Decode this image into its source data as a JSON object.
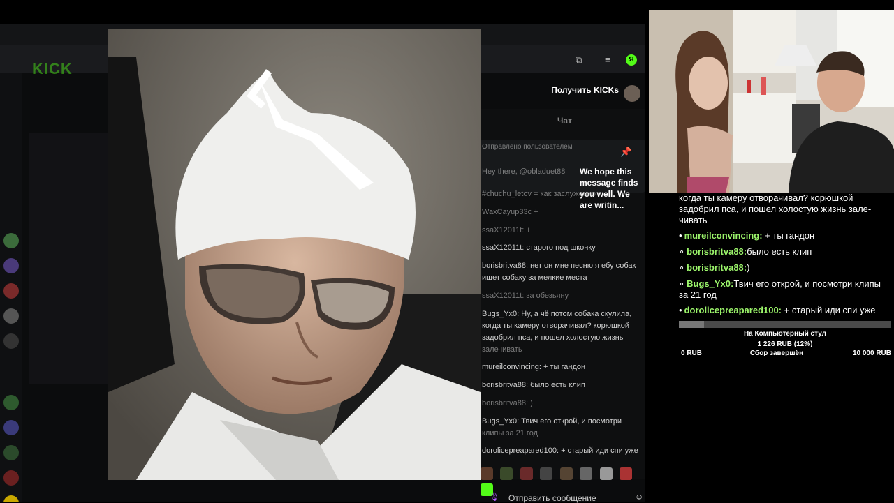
{
  "browser": {
    "logo": "KICK",
    "get_kicks": "Получить KICKs",
    "avatar_letter": "Я",
    "chat_tab": "Чат",
    "pinned_by": "Отправлено пользователем",
    "pinned_text": "We hope this message finds you well. We are writin...",
    "send_placeholder": "Отправить сообщение",
    "chat_lines": [
      "Hey there, @obladuet88",
      "#chuchu_letov = как заслуженно",
      "WaxCayup33c +",
      "ssaX12011t: +",
      "ssaX12011t: старого под шконку",
      "borisbritva88: нет он мне песню я ебу собак",
      "ищет собаку за мелкие места",
      "ssaX12011t: за обезьяну",
      "Bugs_Yx0: Ну, а чё потом собака скулила,",
      "когда ты камеру отворачивал? корюшкой",
      "задобрил пса, и пошел холостую жизнь",
      "залечивать",
      "mureilconvincing: + ты гандон",
      "borisbritva88: было есть клип",
      "borisbritva88: )",
      "Bugs_Yx0: Твич его открой, и посмотри",
      "клипы за 21 год",
      "dorolicepreapared100: + старый иди спи уже"
    ]
  },
  "overlay_chat": {
    "continuation": "когда ты камеру отворачивал? корюшкой задобрил пса, и пошел холостую жизнь зале-чивать",
    "messages": [
      {
        "user": "mureilconvincing:",
        "text": "+ ты гандон"
      },
      {
        "user": "borisbritva88:",
        "text": "было есть клип"
      },
      {
        "user": "borisbritva88:",
        "text": ")"
      },
      {
        "user": "Bugs_Yx0:",
        "text": "Твич его открой, и посмотри клипы за 21 год"
      },
      {
        "user": "dorolicepreapared100:",
        "text": "+ старый иди спи уже"
      }
    ]
  },
  "goal": {
    "title": "На Компьютерный стул",
    "amount": "1 226 RUB (12%)",
    "min": "0 RUB",
    "status": "Сбор завершён",
    "max": "10 000 RUB",
    "progress": 0.12
  },
  "colors": {
    "kick_green": "#53fc18",
    "username_green": "#9cf56b",
    "send_icon": "#b45cff"
  },
  "icons": {
    "mic": "microphone-icon",
    "smile": "emoji-icon",
    "pin": "pin-icon"
  }
}
